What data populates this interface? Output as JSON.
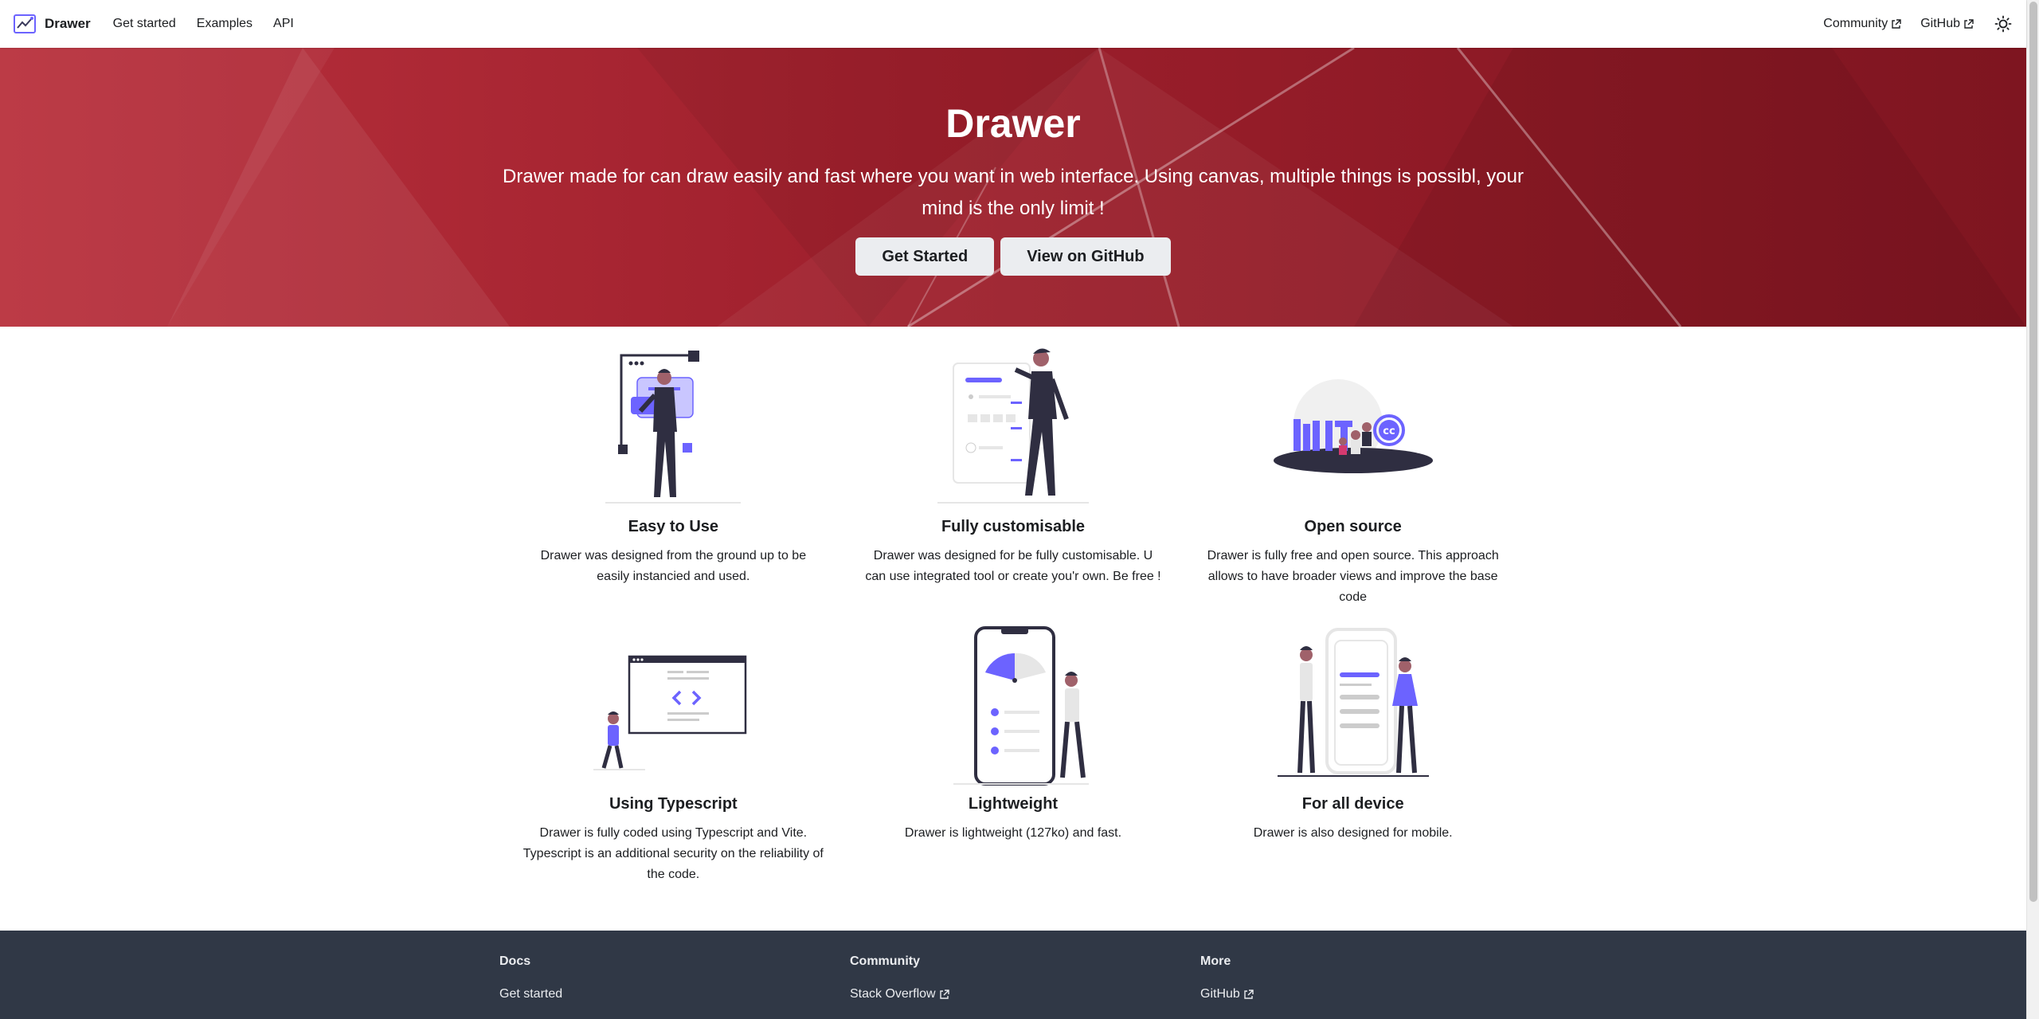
{
  "navbar": {
    "brand": "Drawer",
    "links": [
      "Get started",
      "Examples",
      "API"
    ],
    "right_links": [
      "Community",
      "GitHub"
    ],
    "theme_icon": "sun-icon"
  },
  "hero": {
    "title": "Drawer",
    "subtitle": "Drawer made for can draw easily and fast where you want in web interface. Using canvas, multiple things is possibl, your mind is the only limit !",
    "buttons": [
      "Get Started",
      "View on GitHub"
    ]
  },
  "features": [
    {
      "title": "Easy to Use",
      "description": "Drawer was designed from the ground up to be easily instancied and used.",
      "illustration": "person-dashboard-illustration"
    },
    {
      "title": "Fully customisable",
      "description": "Drawer was designed for be fully customisable. U can use integrated tool or create you'r own. Be free !",
      "illustration": "person-form-illustration"
    },
    {
      "title": "Open source",
      "description": "Drawer is fully free and open source. This approach allows to have broader views and improve the base code",
      "illustration": "mit-cc-illustration"
    },
    {
      "title": "Using Typescript",
      "description": "Drawer is fully coded using Typescript and Vite. Typescript is an additional security on the reliability of the code.",
      "illustration": "code-window-illustration"
    },
    {
      "title": "Lightweight",
      "description": "Drawer is lightweight (127ko) and fast.",
      "illustration": "phone-gauge-illustration"
    },
    {
      "title": "For all device",
      "description": "Drawer is also designed for mobile.",
      "illustration": "people-phone-illustration"
    }
  ],
  "footer": {
    "columns": [
      {
        "title": "Docs",
        "links": [
          "Get started"
        ]
      },
      {
        "title": "Community",
        "links": [
          "Stack Overflow"
        ]
      },
      {
        "title": "More",
        "links": [
          "GitHub"
        ]
      }
    ]
  },
  "colors": {
    "accent": "#6c63ff",
    "hero": "#a3222f",
    "footer": "#303846",
    "dark": "#2f2e41"
  }
}
